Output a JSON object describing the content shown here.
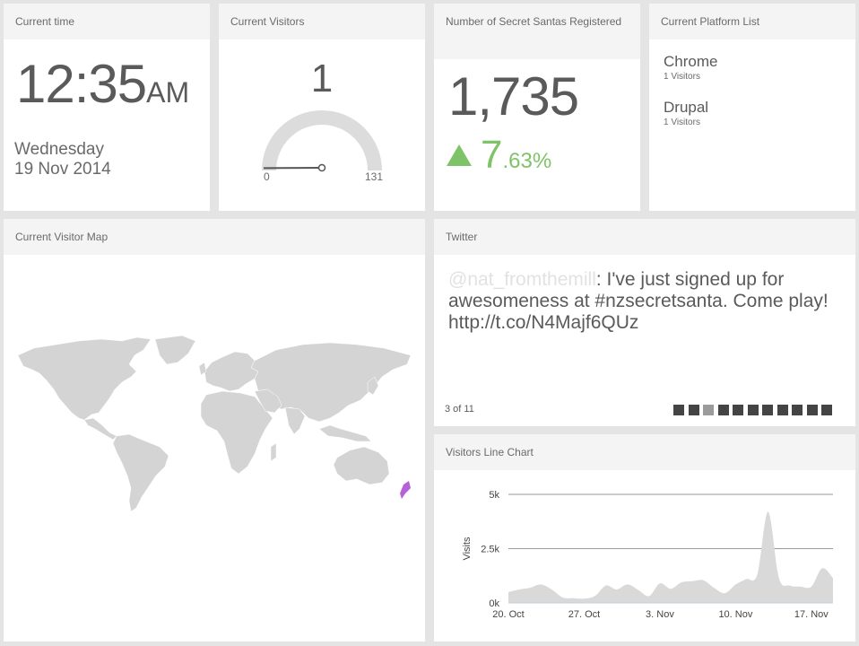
{
  "clock": {
    "title": "Current time",
    "time": "12:35",
    "ampm": "AM",
    "day": "Wednesday",
    "date": "19 Nov 2014"
  },
  "visitors": {
    "title": "Current Visitors",
    "value": "1",
    "min": "0",
    "max": "131",
    "gauge_fraction": 0.0076
  },
  "santas": {
    "title": "Number of Secret Santas Registered",
    "count": "1,735",
    "change_int": "7",
    "change_dec": ".63%",
    "trend": "up",
    "trend_color": "#7fc368"
  },
  "platforms": {
    "title": "Current Platform List",
    "items": [
      {
        "name": "Chrome",
        "sub": "1 Visitors"
      },
      {
        "name": "Drupal",
        "sub": "1 Visitors"
      }
    ]
  },
  "map": {
    "title": "Current Visitor Map",
    "highlight_color": "#b561d8",
    "highlight_region": "New Zealand"
  },
  "twitter": {
    "title": "Twitter",
    "handle": "@nat_fromthemill",
    "text": ": I've just signed up for awesomeness at #nzsecretsanta. Come play! http://t.co/N4Majf6QUz",
    "counter": "3 of 11",
    "total": 11,
    "active_index": 2
  },
  "chart": {
    "title": "Visitors Line Chart"
  },
  "chart_data": {
    "type": "area",
    "title": "",
    "xlabel": "",
    "ylabel": "Visits",
    "ylim": [
      0,
      5000
    ],
    "yticks": [
      "0k",
      "2.5k",
      "5k"
    ],
    "xticks": [
      "20. Oct",
      "27. Oct",
      "3. Nov",
      "10. Nov",
      "17. Nov"
    ],
    "grid": true,
    "series": [
      {
        "values": [
          {
            "x": "2014-10-20",
            "y": 500
          },
          {
            "x": "2014-10-21",
            "y": 620
          },
          {
            "x": "2014-10-22",
            "y": 700
          },
          {
            "x": "2014-10-23",
            "y": 850
          },
          {
            "x": "2014-10-24",
            "y": 620
          },
          {
            "x": "2014-10-25",
            "y": 250
          },
          {
            "x": "2014-10-26",
            "y": 220
          },
          {
            "x": "2014-10-27",
            "y": 200
          },
          {
            "x": "2014-10-28",
            "y": 320
          },
          {
            "x": "2014-10-29",
            "y": 800
          },
          {
            "x": "2014-10-30",
            "y": 620
          },
          {
            "x": "2014-10-31",
            "y": 850
          },
          {
            "x": "2014-11-01",
            "y": 600
          },
          {
            "x": "2014-11-02",
            "y": 320
          },
          {
            "x": "2014-11-03",
            "y": 900
          },
          {
            "x": "2014-11-04",
            "y": 650
          },
          {
            "x": "2014-11-05",
            "y": 950
          },
          {
            "x": "2014-11-06",
            "y": 1000
          },
          {
            "x": "2014-11-07",
            "y": 1050
          },
          {
            "x": "2014-11-08",
            "y": 700
          },
          {
            "x": "2014-11-09",
            "y": 450
          },
          {
            "x": "2014-11-10",
            "y": 850
          },
          {
            "x": "2014-11-11",
            "y": 1100
          },
          {
            "x": "2014-11-12",
            "y": 1300
          },
          {
            "x": "2014-11-13",
            "y": 4200
          },
          {
            "x": "2014-11-14",
            "y": 1150
          },
          {
            "x": "2014-11-15",
            "y": 800
          },
          {
            "x": "2014-11-16",
            "y": 750
          },
          {
            "x": "2014-11-17",
            "y": 750
          },
          {
            "x": "2014-11-18",
            "y": 1600
          },
          {
            "x": "2014-11-19",
            "y": 1150
          }
        ]
      }
    ],
    "fill_color": "#d9d9d9"
  }
}
